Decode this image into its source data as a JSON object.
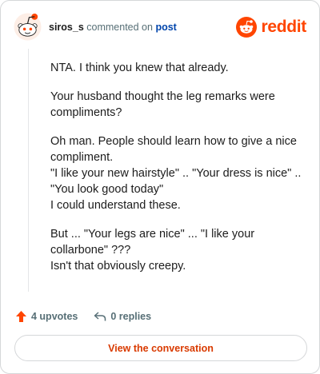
{
  "comment": {
    "username": "siros_s",
    "action_text": "commented on",
    "target_link": "post",
    "paragraphs": [
      "NTA. I think you knew that already.",
      "Your husband thought the leg remarks were compliments?",
      "Oh man. People should learn how to give a nice compliment.\n\"I like your new hairstyle\" .. \"Your dress is nice\" .. \"You look good today\"\nI could understand these.",
      "But ... \"Your legs are nice\" ... \"I like your collarbone\" ???\nIsn't that obviously creepy."
    ]
  },
  "brand": {
    "wordmark": "reddit",
    "icon": "reddit-logo-icon",
    "color": "#ff4500"
  },
  "stats": {
    "upvotes": "4 upvotes",
    "replies": "0 replies"
  },
  "cta_label": "View the conversation",
  "colors": {
    "accent": "#ff4500",
    "link": "#0045ac",
    "muted": "#576f76",
    "cta_text": "#d93a00"
  }
}
